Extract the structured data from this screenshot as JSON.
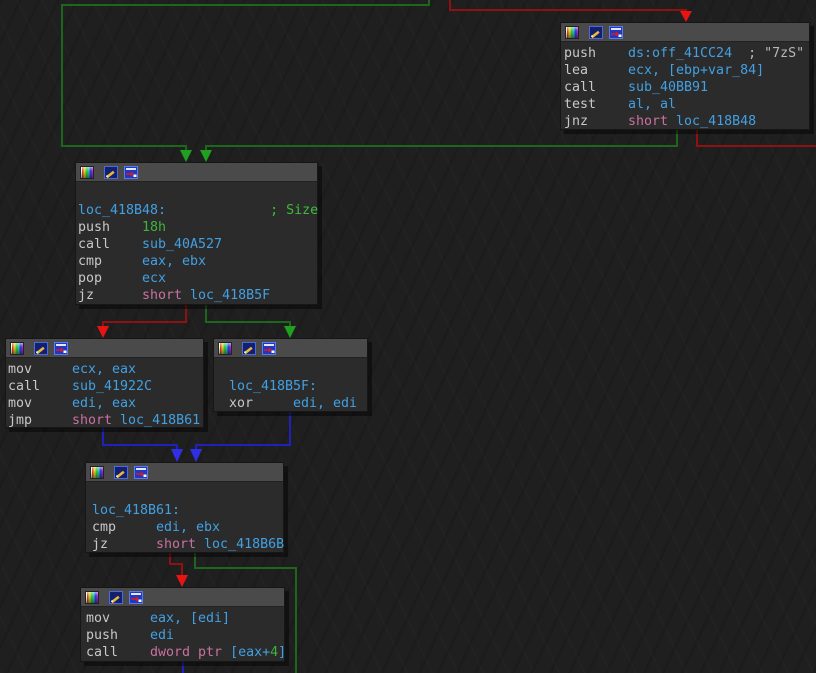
{
  "colors": {
    "green_line": "#1c671c",
    "green_arrow": "#1fa01f",
    "red_line": "#8f1212",
    "red_arrow": "#e81414",
    "blue_line": "#2020bb",
    "blue_arrow": "#2f2fe8"
  },
  "blocks": {
    "a": {
      "address": "sub_40BB91 caller block",
      "rows": [
        [
          {
            "t": "push",
            "c": "mn"
          },
          {
            "t": "ds:off_41CC24",
            "c": "op"
          },
          {
            "t": "  ; \"7zS\"",
            "c": "gray"
          }
        ],
        [
          {
            "t": "lea",
            "c": "mn"
          },
          {
            "t": "ecx, [ebp+var_84]",
            "c": "op"
          }
        ],
        [
          {
            "t": "call",
            "c": "mn"
          },
          {
            "t": "sub_40BB91",
            "c": "op"
          }
        ],
        [
          {
            "t": "test",
            "c": "mn"
          },
          {
            "t": "al, al",
            "c": "op"
          }
        ],
        [
          {
            "t": "jnz",
            "c": "mn"
          },
          {
            "t": "short ",
            "c": "pink"
          },
          {
            "t": "loc_418B48",
            "c": "op"
          }
        ]
      ]
    },
    "b": {
      "address": "loc_418B48",
      "rows": [
        [],
        [
          {
            "t": "loc_418B48:",
            "c": "op"
          },
          {
            "t": "             ; Size",
            "c": "cmt"
          }
        ],
        [
          {
            "t": "push",
            "c": "mn"
          },
          {
            "t": "18h",
            "c": "num"
          }
        ],
        [
          {
            "t": "call",
            "c": "mn"
          },
          {
            "t": "sub_40A527",
            "c": "op"
          }
        ],
        [
          {
            "t": "cmp",
            "c": "mn"
          },
          {
            "t": "eax, ebx",
            "c": "op"
          }
        ],
        [
          {
            "t": "pop",
            "c": "mn"
          },
          {
            "t": "ecx",
            "c": "op"
          }
        ],
        [
          {
            "t": "jz",
            "c": "mn"
          },
          {
            "t": "short ",
            "c": "pink"
          },
          {
            "t": "loc_418B5F",
            "c": "op"
          }
        ]
      ]
    },
    "c": {
      "address": "fallthrough block",
      "rows": [
        [
          {
            "t": "mov",
            "c": "mn"
          },
          {
            "t": "ecx, eax",
            "c": "op"
          }
        ],
        [
          {
            "t": "call",
            "c": "mn"
          },
          {
            "t": "sub_41922C",
            "c": "op"
          }
        ],
        [
          {
            "t": "mov",
            "c": "mn"
          },
          {
            "t": "edi, eax",
            "c": "op"
          }
        ],
        [
          {
            "t": "jmp",
            "c": "mn"
          },
          {
            "t": "short ",
            "c": "pink"
          },
          {
            "t": "loc_418B61",
            "c": "op"
          }
        ]
      ]
    },
    "d": {
      "address": "loc_418B5F",
      "rows": [
        [],
        [
          {
            "t": "loc_418B5F:",
            "c": "op"
          }
        ],
        [
          {
            "t": "xor",
            "c": "mn"
          },
          {
            "t": "edi, edi",
            "c": "op"
          }
        ]
      ]
    },
    "e": {
      "address": "loc_418B61",
      "rows": [
        [],
        [
          {
            "t": "loc_418B61:",
            "c": "op"
          }
        ],
        [
          {
            "t": "cmp",
            "c": "mn"
          },
          {
            "t": "edi, ebx",
            "c": "op"
          }
        ],
        [
          {
            "t": "jz",
            "c": "mn"
          },
          {
            "t": "short ",
            "c": "pink"
          },
          {
            "t": "loc_418B6B",
            "c": "op"
          }
        ]
      ]
    },
    "f": {
      "address": "virtual call block",
      "rows": [
        [
          {
            "t": "mov",
            "c": "mn"
          },
          {
            "t": "eax, [edi]",
            "c": "op"
          }
        ],
        [
          {
            "t": "push",
            "c": "mn"
          },
          {
            "t": "edi",
            "c": "op"
          }
        ],
        [
          {
            "t": "call",
            "c": "mn"
          },
          {
            "t": "dword ptr ",
            "c": "pink"
          },
          {
            "t": "[eax+",
            "c": "op"
          },
          {
            "t": "4",
            "c": "num"
          },
          {
            "t": "]",
            "c": "op"
          }
        ]
      ]
    }
  }
}
